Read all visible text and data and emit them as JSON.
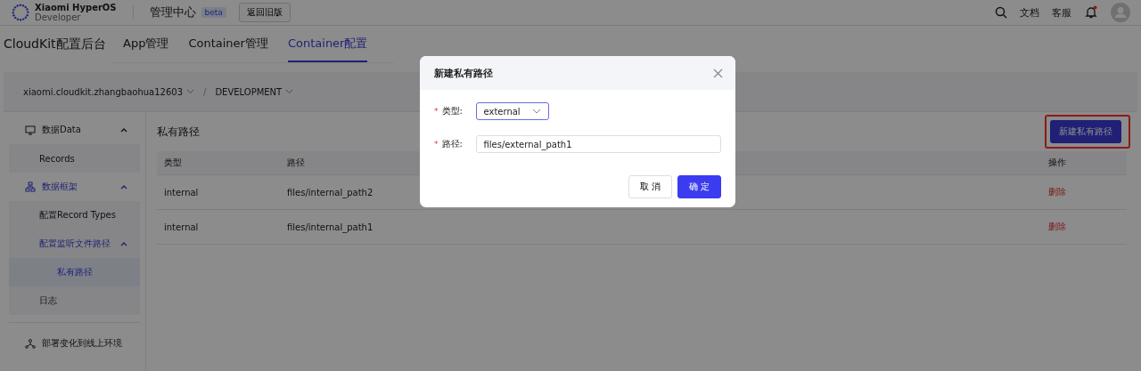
{
  "header": {
    "brand_line1": "Xiaomi HyperOS",
    "brand_line2": "Developer",
    "title": "管理中心",
    "badge": "beta",
    "old_version_button": "返回旧版",
    "links": [
      "文档",
      "客服"
    ],
    "notification_unread": true
  },
  "tabs_title": "CloudKit配置后台",
  "tabs": [
    {
      "label": "App管理",
      "selected": false
    },
    {
      "label": "Container管理",
      "selected": false
    },
    {
      "label": "Container配置",
      "selected": true
    }
  ],
  "breadcrumb": [
    "xiaomi.cloudkit.zhangbaohua12603",
    "DEVELOPMENT"
  ],
  "breadcrumb_separator": "/",
  "sidebar": {
    "items": [
      {
        "label": "数据Data",
        "expanded": true,
        "selected": false,
        "children": [
          {
            "label": "Records",
            "selected": false
          }
        ]
      },
      {
        "label": "数据框架",
        "expanded": true,
        "selected": true,
        "children": [
          {
            "label": "配置Record Types",
            "selected": false
          },
          {
            "label": "配置监听文件路径",
            "expanded": true,
            "selected": true,
            "children": [
              {
                "label": "私有路径",
                "selected": true
              }
            ]
          },
          {
            "label": "日志",
            "selected": false
          }
        ]
      }
    ],
    "deploy": {
      "label": "部署变化到线上环境"
    }
  },
  "content": {
    "title": "私有路径",
    "new_button": "新建私有路径",
    "new_button_highlighted": true,
    "table": {
      "columns": [
        "类型",
        "路径",
        "操作"
      ],
      "rows": [
        {
          "type": "internal",
          "path": "files/internal_path2",
          "action": "删除"
        },
        {
          "type": "internal",
          "path": "files/internal_path1",
          "action": "删除"
        }
      ]
    }
  },
  "dialog": {
    "title": "新建私有路径",
    "fields": [
      {
        "kind": "select",
        "label": "类型:",
        "required_mark": "*",
        "value": "external",
        "focused": true
      },
      {
        "kind": "text",
        "label": "路径:",
        "required_mark": "*",
        "value": "files/external_path1",
        "focused": false
      }
    ],
    "cancel": "取 消",
    "ok": "确 定"
  }
}
